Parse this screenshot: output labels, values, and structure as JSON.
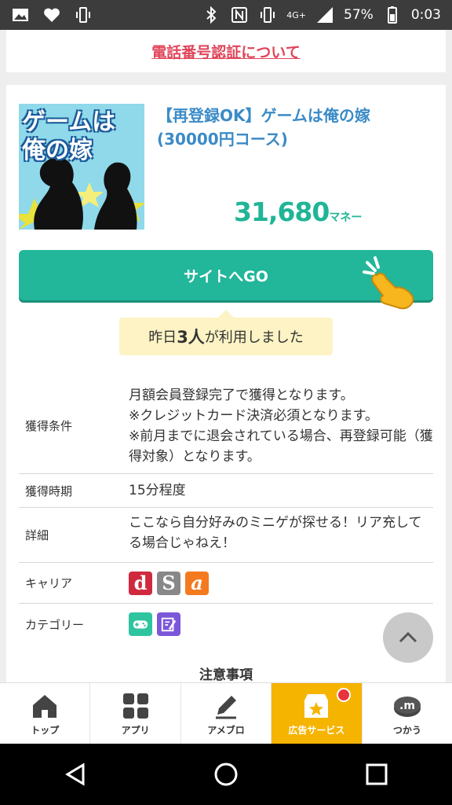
{
  "status_bar": {
    "network": "4G+",
    "battery": "57%",
    "time": "0:03"
  },
  "top_link": "電話番号認証について",
  "offer": {
    "title": "【再登録OK】ゲームは俺の嫁(30000円コース)",
    "thumbnail_text_line1": "ゲームは",
    "thumbnail_text_line2": "俺の嫁",
    "price": "31,680",
    "price_unit": "マネー",
    "go_button": "サイトへGO",
    "usage_prefix": "昨日",
    "usage_count": "3人",
    "usage_suffix": "が利用しました"
  },
  "info": {
    "condition_label": "獲得条件",
    "condition_line1": "月額会員登録完了で獲得となります。",
    "condition_line2": "※クレジットカード決済必須となります。",
    "condition_line3": "※前月までに退会されている場合、再登録可能（獲得対象）となります。",
    "timing_label": "獲得時期",
    "timing_value": "15分程度",
    "detail_label": "詳細",
    "detail_value": "ここなら自分好みのミニゲが探せる！リア充してる場合じゃねえ！",
    "carrier_label": "キャリア",
    "carriers": [
      "d",
      "S",
      "a"
    ],
    "carrier_colors": [
      "#d0293e",
      "#888888",
      "#f47a1f"
    ],
    "category_label": "カテゴリー",
    "category_icons": [
      "gamepad-icon",
      "edit-note-icon"
    ],
    "category_colors": [
      "#2fc4a0",
      "#7b57d9"
    ]
  },
  "notice_title": "注意事項",
  "bottom_nav": {
    "items": [
      {
        "label": "トップ",
        "icon": "home-icon"
      },
      {
        "label": "アプリ",
        "icon": "grid-icon"
      },
      {
        "label": "アメブロ",
        "icon": "pen-icon"
      },
      {
        "label": "広告サービス",
        "icon": "star-box-icon"
      },
      {
        "label": "つかう",
        "icon": "money-icon"
      }
    ],
    "active_index": 3,
    "active_color": "#f5b400"
  },
  "colors": {
    "accent": "#22b69a",
    "link": "#e0455a",
    "title": "#3b8bc7"
  }
}
